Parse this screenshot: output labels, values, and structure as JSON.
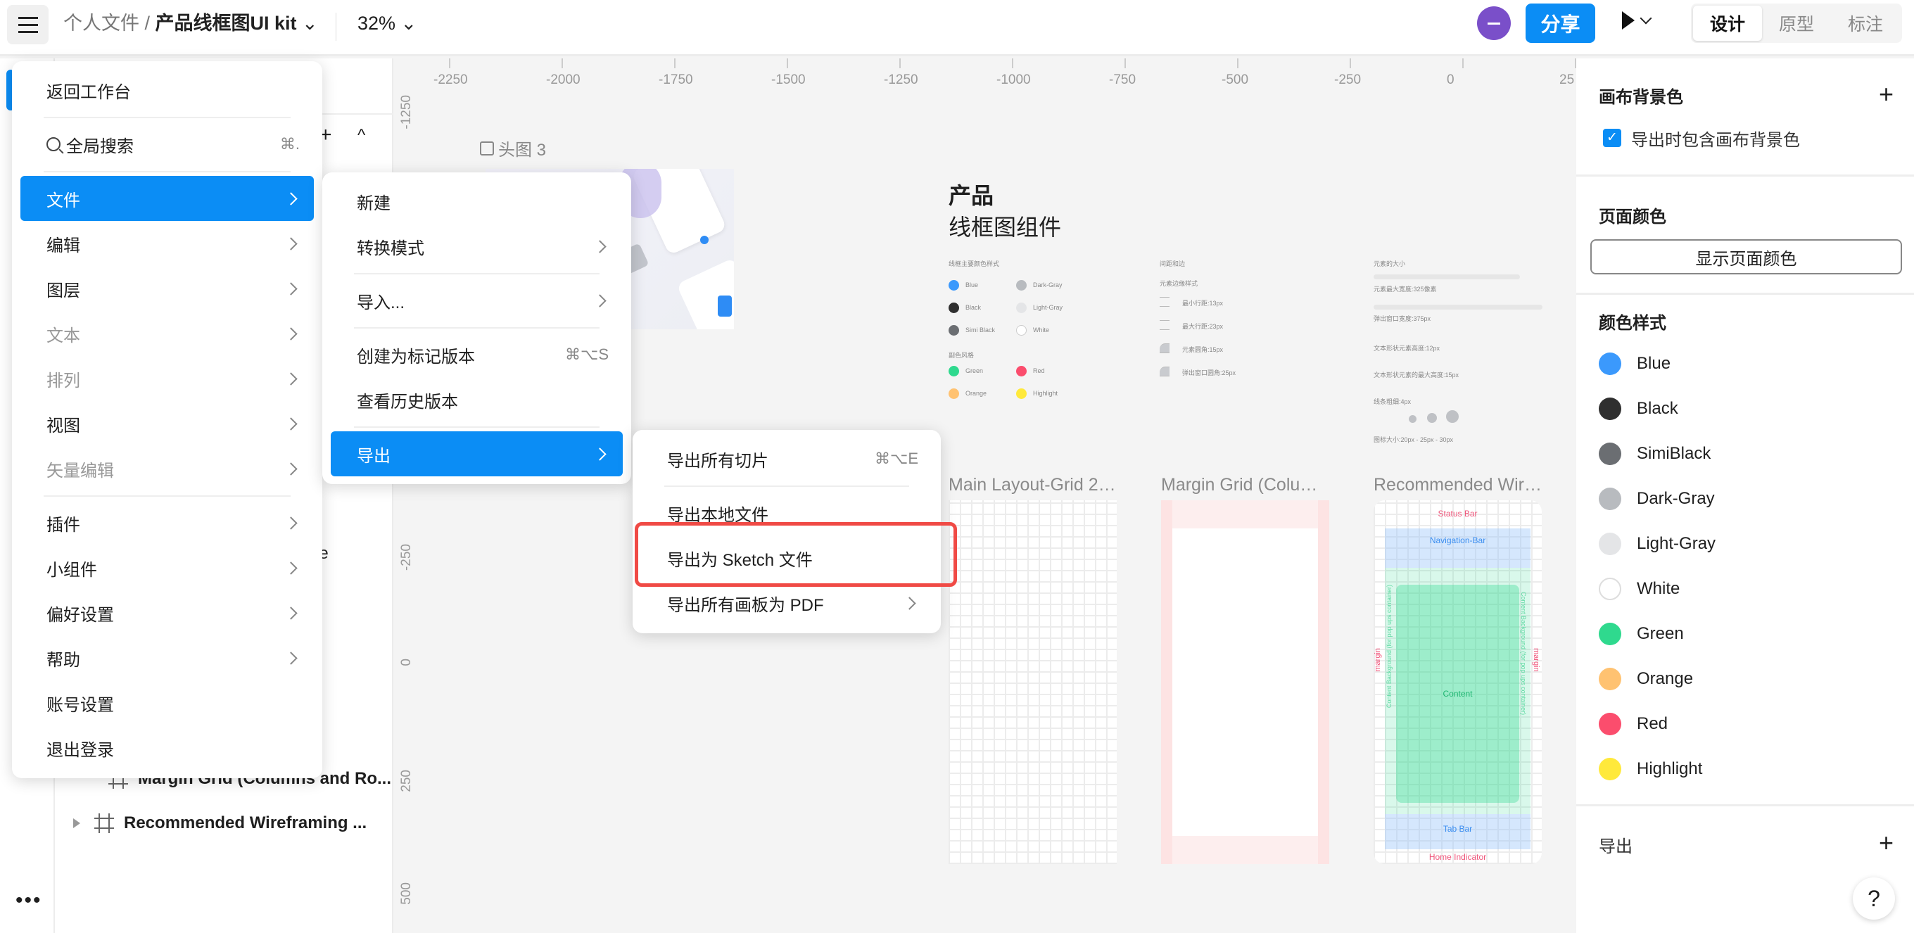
{
  "topbar": {
    "parent": "个人文件",
    "separator": " / ",
    "file": "产品线框图UI kit",
    "zoom": "32%",
    "share": "分享",
    "modes": [
      "设计",
      "原型",
      "标注"
    ],
    "active_mode": "设计"
  },
  "rulers": {
    "x_labels": [
      "-2250",
      "-2000",
      "-1750",
      "-1500",
      "-1250",
      "-1000",
      "-750",
      "-500",
      "-250",
      "0",
      "25"
    ],
    "y_labels": [
      "-1250",
      "-250",
      "0",
      "250",
      "500"
    ]
  },
  "layers": {
    "partial": "le",
    "items": [
      {
        "label": "Margin Grid (Columns and Ro..."
      },
      {
        "label": "Recommended Wireframing ..."
      }
    ]
  },
  "main_menu": [
    [
      {
        "label": "返回工作台"
      }
    ],
    [
      {
        "label": "全局搜索",
        "shortcut": "⌘.",
        "icon": "search-icon"
      }
    ],
    [
      {
        "label": "文件",
        "chevron": true,
        "active": true
      },
      {
        "label": "编辑",
        "chevron": true
      },
      {
        "label": "图层",
        "chevron": true
      },
      {
        "label": "文本",
        "chevron": true,
        "disabled": true
      },
      {
        "label": "排列",
        "chevron": true,
        "disabled": true
      },
      {
        "label": "视图",
        "chevron": true
      },
      {
        "label": "矢量编辑",
        "chevron": true,
        "disabled": true
      }
    ],
    [
      {
        "label": "插件",
        "chevron": true
      },
      {
        "label": "小组件",
        "chevron": true
      },
      {
        "label": "偏好设置",
        "chevron": true
      },
      {
        "label": "帮助",
        "chevron": true
      },
      {
        "label": "账号设置"
      },
      {
        "label": "退出登录"
      }
    ]
  ],
  "file_menu": [
    [
      {
        "label": "新建"
      },
      {
        "label": "转换模式",
        "chevron": true
      }
    ],
    [
      {
        "label": "导入...",
        "chevron": true
      }
    ],
    [
      {
        "label": "创建为标记版本",
        "shortcut": "⌘⌥S"
      },
      {
        "label": "查看历史版本"
      }
    ],
    [
      {
        "label": "导出",
        "chevron": true,
        "active": true
      }
    ]
  ],
  "export_menu": [
    [
      {
        "label": "导出所有切片",
        "shortcut": "⌘⌥E"
      }
    ],
    [
      {
        "label": "导出本地文件"
      },
      {
        "label": "导出为 Sketch 文件",
        "highlighted_box": true
      },
      {
        "label": "导出所有画板为 PDF",
        "chevron": true
      }
    ]
  ],
  "canvas": {
    "hero_label": "头图 3",
    "title1": "产品",
    "title2": "线框图组件",
    "col1_title": "线框主要颜色样式",
    "col1_sub": "副色风格",
    "main_colors": [
      {
        "name": "Blue",
        "color": "#3b99fc"
      },
      {
        "name": "Dark-Gray",
        "color": "#b8bbbf"
      },
      {
        "name": "Black",
        "color": "#2f2f2f"
      },
      {
        "name": "Light-Gray",
        "color": "#e4e5e7"
      },
      {
        "name": "Simi Black",
        "color": "#6b6e72"
      },
      {
        "name": "White",
        "color": "#ffffff"
      }
    ],
    "sub_colors": [
      {
        "name": "Green",
        "color": "#2fd98e"
      },
      {
        "name": "Red",
        "color": "#fb4d6d"
      },
      {
        "name": "Orange",
        "color": "#ffc271"
      },
      {
        "name": "Highlight",
        "color": "#ffe93b"
      }
    ],
    "col2_title": "间距和边",
    "col2_sub": "元素边缘样式",
    "spacing": [
      "最小行距:13px",
      "最大行距:23px",
      "元素圆角:15px",
      "弹出窗口圆角:25px"
    ],
    "col3_title": "元素的大小",
    "sizes": [
      "元素最大宽度:325像素",
      "弹出窗口宽度:375px",
      "文本形状元素高度:12px",
      "文本形状元素的最大高度:15px",
      "线条粗细:4px",
      "图标大小:20px - 25px - 30px"
    ],
    "frames": [
      "Main Layout-Grid 2…",
      "Margin Grid (Colu…",
      "Recommended Wir…"
    ],
    "wire": {
      "status": "Status Bar",
      "nav": "Navigation-Bar",
      "content": "Content",
      "tab": "Tab Bar",
      "home": "Home Indicator",
      "margin": "margin",
      "bg": "Content Background (for pop ups container)"
    }
  },
  "right_panel": {
    "canvas_bg": "画布背景色",
    "include_bg": "导出时包含画布背景色",
    "include_bg_checked": true,
    "page_color": "页面颜色",
    "show_page_color": "显示页面颜色",
    "color_styles": "颜色样式",
    "export": "导出",
    "colors": [
      {
        "name": "Blue",
        "color": "#3b99fc"
      },
      {
        "name": "Black",
        "color": "#2f2f2f"
      },
      {
        "name": "SimiBlack",
        "color": "#6b6e72"
      },
      {
        "name": "Dark-Gray",
        "color": "#b8bbbf"
      },
      {
        "name": "Light-Gray",
        "color": "#e4e5e7"
      },
      {
        "name": "White",
        "color": "#ffffff"
      },
      {
        "name": "Green",
        "color": "#2fd98e"
      },
      {
        "name": "Orange",
        "color": "#ffc271"
      },
      {
        "name": "Red",
        "color": "#fb4d6d"
      },
      {
        "name": "Highlight",
        "color": "#ffe93b"
      }
    ]
  },
  "help": "?",
  "accent": "#0b8df5"
}
